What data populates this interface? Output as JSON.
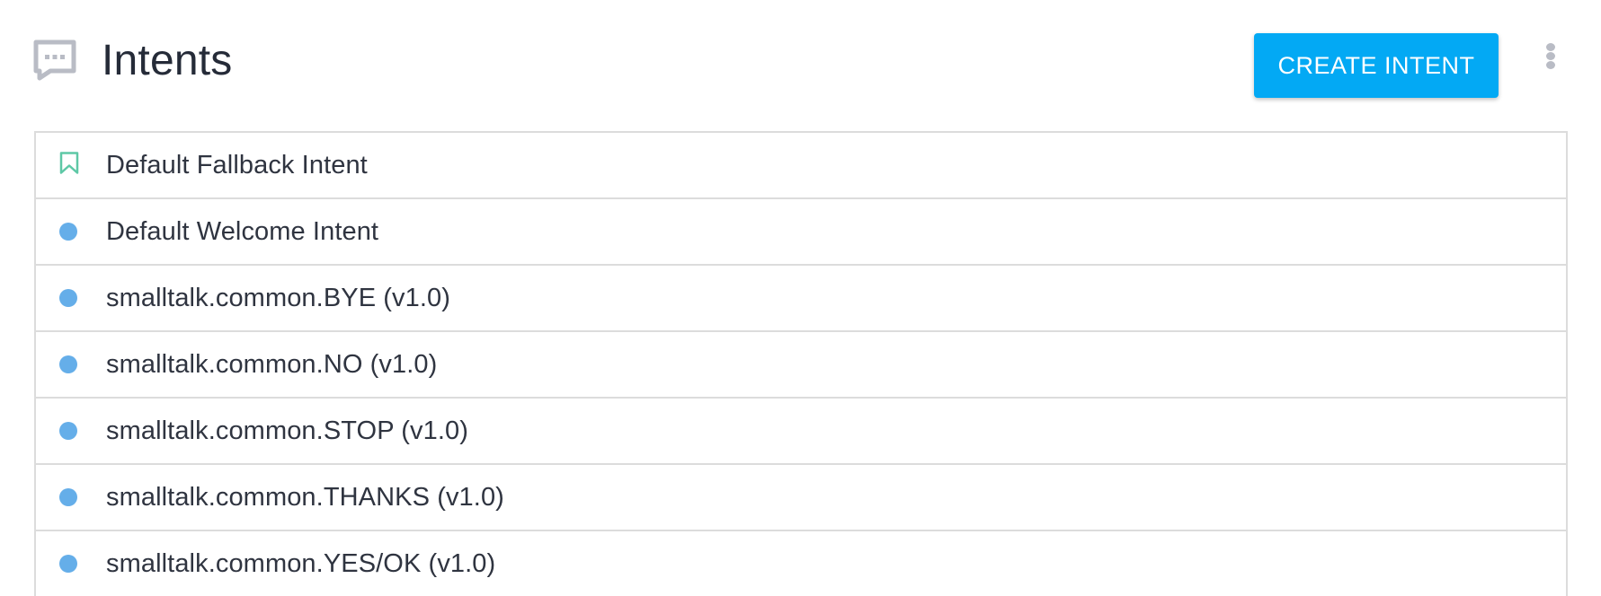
{
  "header": {
    "icon": "chat-bubble-icon",
    "title": "Intents",
    "create_button_label": "CREATE INTENT",
    "more_menu_icon": "more-vert-icon"
  },
  "colors": {
    "primary_button": "#03a9f4",
    "dot": "#65aee9",
    "bookmark": "#5ec8a6",
    "icon_gray": "#b9bcc5",
    "divider": "#dcdcdc"
  },
  "intents": [
    {
      "label": "Default Fallback Intent",
      "marker": "bookmark-icon"
    },
    {
      "label": "Default Welcome Intent",
      "marker": "dot-icon"
    },
    {
      "label": "smalltalk.common.BYE (v1.0)",
      "marker": "dot-icon"
    },
    {
      "label": "smalltalk.common.NO (v1.0)",
      "marker": "dot-icon"
    },
    {
      "label": "smalltalk.common.STOP (v1.0)",
      "marker": "dot-icon"
    },
    {
      "label": "smalltalk.common.THANKS (v1.0)",
      "marker": "dot-icon"
    },
    {
      "label": "smalltalk.common.YES/OK (v1.0)",
      "marker": "dot-icon"
    }
  ]
}
